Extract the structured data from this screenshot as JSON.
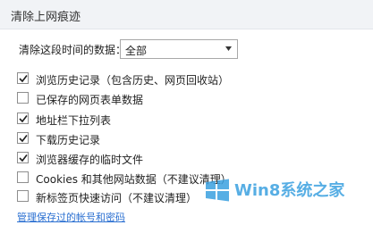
{
  "window": {
    "title": "清除上网痕迹"
  },
  "range": {
    "label": "清除这段时间的数据：",
    "selected": "全部"
  },
  "options": [
    {
      "label": "浏览历史记录（包含历史、网页回收站）",
      "checked": true
    },
    {
      "label": "已保存的网页表单数据",
      "checked": false
    },
    {
      "label": "地址栏下拉列表",
      "checked": true
    },
    {
      "label": "下载历史记录",
      "checked": true
    },
    {
      "label": "浏览器缓存的临时文件",
      "checked": true
    },
    {
      "label": "Cookies 和其他网站数据（不建议清理）",
      "checked": false
    },
    {
      "label": "新标签页快速访问（不建议清理）",
      "checked": false
    }
  ],
  "link": {
    "label": "管理保存过的帐号和密码"
  },
  "watermark": {
    "text": "Win8系统之家"
  },
  "colors": {
    "link": "#2a6fd1",
    "check": "#1f1f1f",
    "watermark": "#3aa0e0"
  }
}
